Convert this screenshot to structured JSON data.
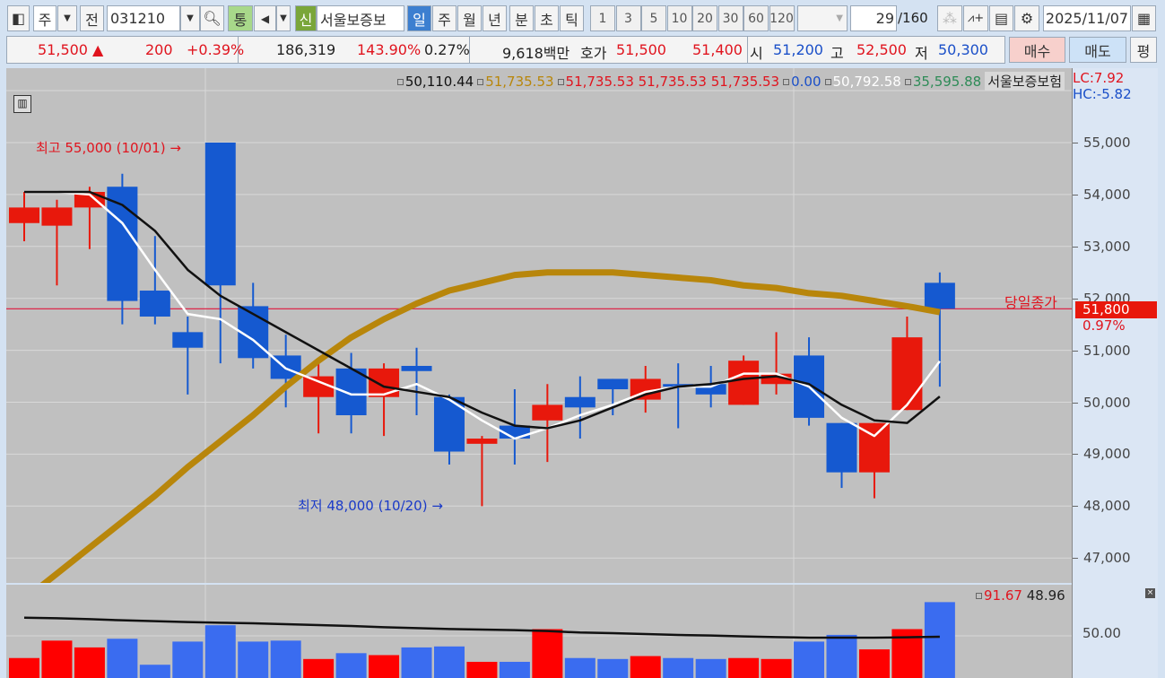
{
  "toolbar": {
    "layout_icon": "panel-layout-icon",
    "period_type": "주",
    "dropdown_icon": "chevron-down-icon",
    "jeon": "전",
    "code": "031210",
    "search_icon": "search-icon",
    "tong": "통",
    "speaker_icon": "speaker-icon",
    "shin": "신",
    "stock_name": "서울보증보",
    "periods": [
      "일",
      "주",
      "월",
      "년",
      "분",
      "초",
      "틱"
    ],
    "active_period": "일",
    "intervals": [
      "1",
      "3",
      "5",
      "10",
      "20",
      "30",
      "60",
      "120"
    ],
    "count": "29",
    "count_total": "/160",
    "tools": [
      "candle-settings-icon",
      "add-indicator-icon",
      "save-icon",
      "gear-icon"
    ],
    "date": "2025/11/07",
    "calendar_icon": "calendar-icon"
  },
  "quote": {
    "price": "51,500",
    "arrow": "▲",
    "change": "200",
    "change_pct": "+0.39%",
    "volume": "186,319",
    "volume_ratio": "143.90%",
    "turnover": "0.27%",
    "amount": "9,618백만",
    "hoga_label": "호가",
    "ask": "51,500",
    "bid": "51,400",
    "open_label": "시",
    "open": "51,200",
    "high_label": "고",
    "high": "52,500",
    "low_label": "저",
    "low": "50,300",
    "buy": "매수",
    "sell": "매도",
    "eval": "평"
  },
  "legend": {
    "items": [
      {
        "text": "50,110.44",
        "color": "#111111"
      },
      {
        "text": "51,735.53",
        "color": "#b8860b"
      },
      {
        "text": "51,735.53 51,735.53 51,735.53",
        "color": "#e0141e"
      },
      {
        "text": "0.00",
        "color": "#1a4fc8"
      },
      {
        "text": "50,792.58",
        "color": "#ffffff"
      },
      {
        "text": "35,595.88",
        "color": "#2e8b57"
      }
    ],
    "name": "서울보증보험",
    "lc": "LC:7.92",
    "hc": "HC:-5.82"
  },
  "annotations": {
    "high": "최고 55,000 (10/01)",
    "low": "최저 48,000 (10/20)",
    "close_label": "당일종가",
    "close_price": "51,800",
    "close_pct": "0.97%"
  },
  "axis": {
    "ticks": [
      "55,000",
      "54,000",
      "53,000",
      "52,000",
      "51,000",
      "50,000",
      "49,000",
      "48,000",
      "47,000"
    ],
    "volume_tick": "50.00"
  },
  "volume_legend": {
    "v1": "91.67",
    "v2": "48.96"
  },
  "colors": {
    "up": "#e8180c",
    "down": "#1559d0",
    "ma_white": "#ffffff",
    "ma_black": "#111111",
    "ma_gold": "#b8860b",
    "vol_up": "#ff0000",
    "vol_down": "#3a6cf0"
  },
  "chart_data": {
    "type": "candlestick",
    "ylim": [
      46550,
      55300
    ],
    "candles": [
      [
        53450,
        53750,
        54050,
        53100
      ],
      [
        53400,
        53750,
        53900,
        52250
      ],
      [
        53750,
        54050,
        54150,
        52950
      ],
      [
        54150,
        51950,
        54400,
        51500
      ],
      [
        52150,
        51650,
        53200,
        51500
      ],
      [
        51350,
        51050,
        51650,
        50150
      ],
      [
        55000,
        52250,
        55000,
        50750
      ],
      [
        51850,
        50850,
        52300,
        50650
      ],
      [
        50900,
        50450,
        51300,
        49900
      ],
      [
        50100,
        50500,
        50850,
        49400
      ],
      [
        50650,
        49750,
        50950,
        49400
      ],
      [
        50100,
        50650,
        50750,
        49350
      ],
      [
        50700,
        50600,
        51050,
        49750
      ],
      [
        50100,
        49050,
        50150,
        48800
      ],
      [
        49200,
        49300,
        49350,
        48000
      ],
      [
        49550,
        49300,
        50250,
        48800
      ],
      [
        49650,
        49950,
        50350,
        48850
      ],
      [
        50100,
        49900,
        50500,
        49300
      ],
      [
        50450,
        50250,
        50450,
        49750
      ],
      [
        50050,
        50450,
        50700,
        49800
      ],
      [
        50350,
        50300,
        50750,
        49500
      ],
      [
        50350,
        50150,
        50700,
        49900
      ],
      [
        49950,
        50800,
        50900,
        49950
      ],
      [
        50350,
        50550,
        51350,
        50150
      ],
      [
        50900,
        49700,
        51250,
        49550
      ],
      [
        49600,
        48650,
        49600,
        48350
      ],
      [
        48650,
        49600,
        49600,
        48150
      ],
      [
        49850,
        51250,
        51650,
        49850
      ],
      [
        52300,
        51800,
        52500,
        50300
      ]
    ],
    "ma_white": [
      54050,
      54050,
      54000,
      53450,
      52550,
      51700,
      51600,
      51200,
      50650,
      50400,
      50150,
      50150,
      50350,
      50050,
      49650,
      49300,
      49500,
      49750,
      49950,
      50200,
      50300,
      50300,
      50550,
      50550,
      50300,
      49700,
      49350,
      49950,
      50790
    ],
    "ma_black": [
      54050,
      54050,
      54050,
      53800,
      53300,
      52550,
      52050,
      51700,
      51350,
      51000,
      50650,
      50300,
      50200,
      50100,
      49800,
      49550,
      49500,
      49650,
      49900,
      50150,
      50300,
      50350,
      50450,
      50500,
      50350,
      49950,
      49650,
      49600,
      50110
    ],
    "ma_gold": [
      46200,
      46700,
      47200,
      47700,
      48200,
      48750,
      49250,
      49750,
      50300,
      50800,
      51250,
      51600,
      51900,
      52150,
      52300,
      52450,
      52500,
      52500,
      52500,
      52450,
      52400,
      52350,
      52250,
      52200,
      52100,
      52050,
      51950,
      51850,
      51735
    ],
    "volume": [
      22.6,
      44.1,
      35.7,
      46.4,
      14.3,
      42.9,
      63.1,
      42.9,
      44.1,
      21.4,
      28.6,
      26.2,
      35.7,
      36.9,
      17.9,
      17.9,
      58.3,
      22.6,
      21.4,
      25.0,
      22.6,
      21.4,
      22.6,
      21.4,
      42.9,
      51.2,
      33.3,
      58.3,
      91.67
    ],
    "volume_up": [
      1,
      1,
      1,
      0,
      0,
      0,
      0,
      0,
      0,
      1,
      0,
      1,
      0,
      0,
      1,
      0,
      1,
      0,
      0,
      1,
      0,
      0,
      1,
      1,
      0,
      0,
      1,
      1,
      0
    ],
    "volume_ma": [
      72.5,
      71.8,
      70.7,
      69.2,
      68.1,
      67.0,
      66.2,
      65.5,
      64.4,
      63.3,
      62.2,
      60.7,
      59.6,
      58.5,
      57.8,
      57.0,
      55.9,
      54.1,
      53.3,
      52.2,
      51.1,
      50.4,
      49.3,
      48.5,
      47.8,
      47.8,
      47.8,
      48.2,
      48.96
    ]
  }
}
